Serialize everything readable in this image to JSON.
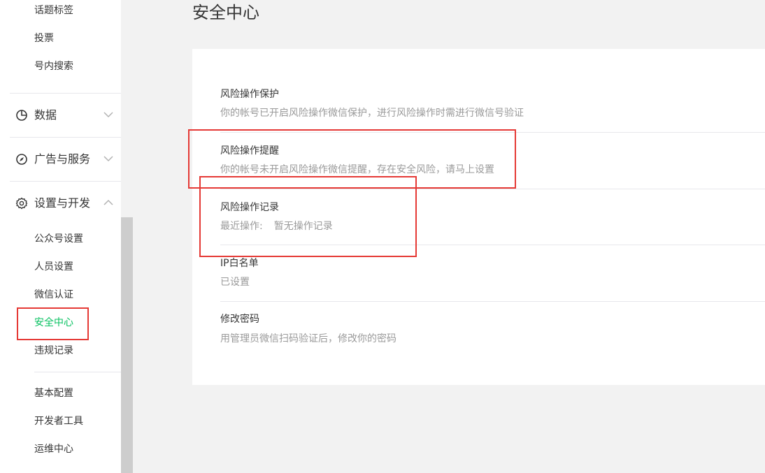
{
  "sidebar": {
    "top_items": [
      "话题标签",
      "投票",
      "号内搜索"
    ],
    "groups": {
      "data": {
        "label": "数据",
        "icon": "pie-chart-icon",
        "expanded": false
      },
      "ads": {
        "label": "广告与服务",
        "icon": "compass-icon",
        "expanded": false
      },
      "settings": {
        "label": "设置与开发",
        "icon": "gear-icon",
        "expanded": true
      }
    },
    "settings_items": [
      "公众号设置",
      "人员设置",
      "微信认证",
      "安全中心",
      "违规记录"
    ],
    "dev_items": [
      "基本配置",
      "开发者工具",
      "运维中心"
    ],
    "active_item": "安全中心"
  },
  "page": {
    "title": "安全中心"
  },
  "security": {
    "risk_protect": {
      "title": "风险操作保护",
      "desc": "你的帐号已开启风险操作微信保护，进行风险操作时需进行微信号验证"
    },
    "risk_remind": {
      "title": "风险操作提醒",
      "desc": "你的帐号未开启风险操作微信提醒，存在安全风险，请马上设置"
    },
    "risk_log": {
      "title": "风险操作记录",
      "label": "最近操作:",
      "value": "暂无操作记录"
    },
    "ip_whitelist": {
      "title": "IP白名单",
      "desc": "已设置"
    },
    "change_password": {
      "title": "修改密码",
      "desc": "用管理员微信扫码验证后，修改你的密码"
    }
  },
  "colors": {
    "accent": "#07c160",
    "highlight_box": "#e53935",
    "text_primary": "#353535",
    "text_secondary": "#9a9a9a"
  }
}
